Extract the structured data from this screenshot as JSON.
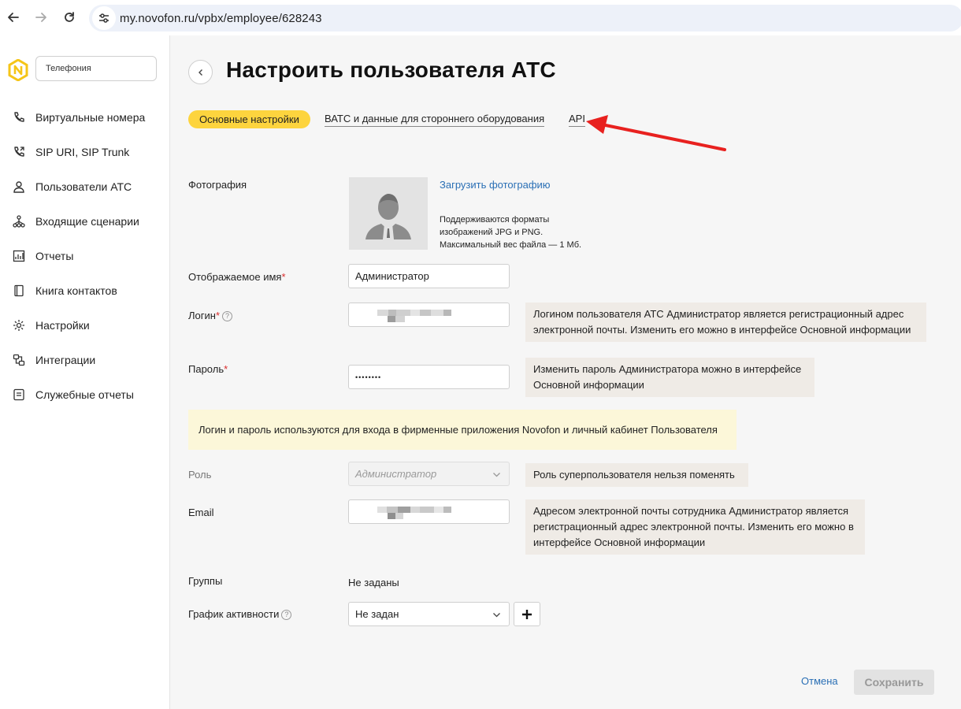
{
  "browser": {
    "url": "my.novofon.ru/vpbx/employee/628243"
  },
  "sidebar": {
    "section": "Телефония",
    "items": [
      {
        "label": "Виртуальные номера",
        "icon": "phone-icon"
      },
      {
        "label": "SIP URI, SIP Trunk",
        "icon": "phone-forward-icon"
      },
      {
        "label": "Пользователи АТС",
        "icon": "user-icon"
      },
      {
        "label": "Входящие сценарии",
        "icon": "flow-icon"
      },
      {
        "label": "Отчеты",
        "icon": "chart-icon"
      },
      {
        "label": "Книга контактов",
        "icon": "book-icon"
      },
      {
        "label": "Настройки",
        "icon": "gear-icon"
      },
      {
        "label": "Интеграции",
        "icon": "integration-icon"
      },
      {
        "label": "Служебные отчеты",
        "icon": "report-icon"
      }
    ]
  },
  "page": {
    "title": "Настроить пользователя АТС",
    "tabs": [
      {
        "label": "Основные настройки",
        "active": true
      },
      {
        "label": "ВАТС и данные для стороннего оборудования",
        "active": false
      },
      {
        "label": "API",
        "active": false
      }
    ]
  },
  "form": {
    "photo": {
      "label": "Фотография",
      "upload_link": "Загрузить фотографию",
      "note_line1": "Поддерживаются форматы",
      "note_line2": "изображений JPG и PNG.",
      "note_line3": "Максимальный вес файла — 1 Мб."
    },
    "display_name": {
      "label": "Отображаемое имя",
      "value": "Администратор"
    },
    "login": {
      "label": "Логин",
      "hint": "Логином пользователя АТС Администратор является регистрационный адрес электронной почты. Изменить его можно в интерфейсе Основной информации"
    },
    "password": {
      "label": "Пароль",
      "value": "••••••••",
      "hint": "Изменить пароль Администратора можно в интерфейсе Основной информации"
    },
    "notice": "Логин и пароль используются для входа в фирменные приложения Novofon и личный кабинет Пользователя",
    "role": {
      "label": "Роль",
      "value": "Администратор",
      "hint": "Роль суперпользователя нельзя поменять"
    },
    "email": {
      "label": "Email",
      "hint": "Адресом электронной почты сотрудника Администратор является регистрационный адрес электронной почты. Изменить его можно в интерфейсе Основной информации"
    },
    "groups": {
      "label": "Группы",
      "value": "Не заданы"
    },
    "schedule": {
      "label": "График активности",
      "value": "Не задан"
    }
  },
  "actions": {
    "cancel": "Отмена",
    "save": "Сохранить"
  },
  "colors": {
    "accent": "#fdd43e",
    "link": "#2a6fb5",
    "required": "#d92b2b",
    "annotation_arrow": "#e8211f"
  }
}
